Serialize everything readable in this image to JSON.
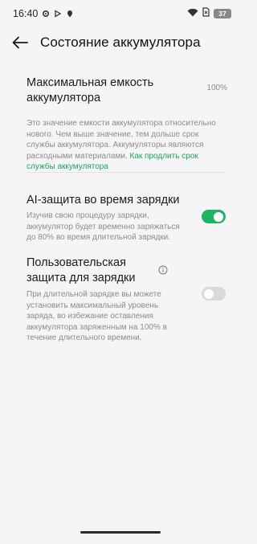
{
  "status_bar": {
    "time": "16:40",
    "battery": "37",
    "icons": [
      "gear-icon",
      "play-icon",
      "location-icon",
      "wifi-icon",
      "sim-icon",
      "battery-icon"
    ]
  },
  "header": {
    "title": "Состояние аккумулятора",
    "back_icon": "arrow-left-icon"
  },
  "capacity": {
    "label": "Максимальная емкость аккумулятора",
    "value": "100%",
    "note": "Это значение емкости аккумулятора относительно нового. Чем выше значение, тем дольше срок службы аккумулятора. Аккумуляторы являются расходными материалами.",
    "link": "Как продлить срок службы аккумулятора"
  },
  "ai_protection": {
    "label": "AI-защита во время зарядки",
    "description": "Изучив свою процедуру зарядки, аккумулятор будет временно заряжаться до 80% во время длительной зарядки.",
    "enabled": true
  },
  "custom_protection": {
    "label": "Пользовательская защита для зарядки",
    "description": "При длительной зарядке вы можете установить максимальный уровень заряда, во избежание оставления аккумулятора заряженным на 100% в течение длительного времени.",
    "enabled": false,
    "info_icon": "info-icon"
  },
  "colors": {
    "accent": "#1fb460",
    "link": "#1aa35a",
    "background": "#f5f5f7"
  }
}
